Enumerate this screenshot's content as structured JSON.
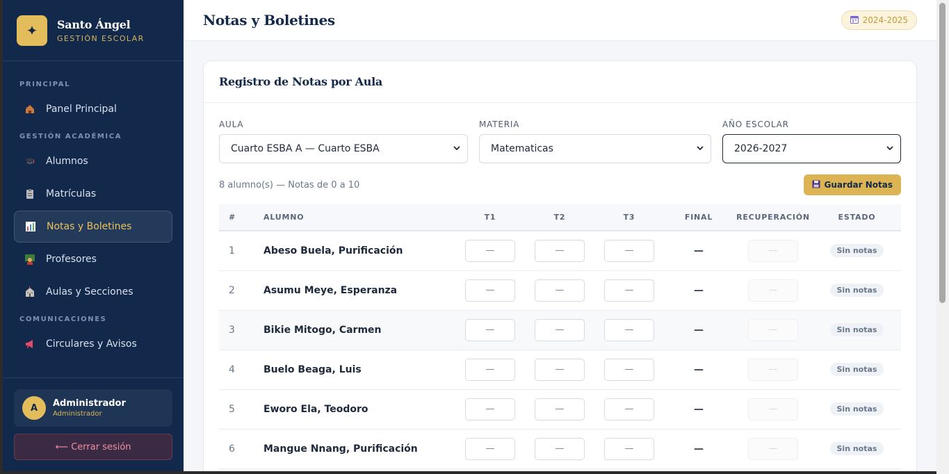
{
  "brand": {
    "name": "Santo Ángel",
    "subtitle": "GESTIÓN ESCOLAR",
    "logo_icon": "sparkle-icon"
  },
  "nav": {
    "section_principal": "PRINCIPAL",
    "section_academica": "GESTIÓN ACADÉMICA",
    "section_comunicaciones": "COMUNICACIONES",
    "items": [
      {
        "label": "Panel Principal",
        "icon": "house-icon"
      },
      {
        "label": "Alumnos",
        "icon": "graduation-cap-icon"
      },
      {
        "label": "Matrículas",
        "icon": "clipboard-icon"
      },
      {
        "label": "Notas y Boletines",
        "icon": "bar-chart-icon",
        "active": true
      },
      {
        "label": "Profesores",
        "icon": "teacher-icon"
      },
      {
        "label": "Aulas y Secciones",
        "icon": "school-icon"
      },
      {
        "label": "Circulares y Avisos",
        "icon": "megaphone-icon"
      }
    ]
  },
  "user": {
    "initial": "A",
    "name": "Administrador",
    "role": "Administrador"
  },
  "logout_label": "⟵ Cerrar sesión",
  "header": {
    "title": "Notas y Boletines",
    "year_badge": "2024-2025"
  },
  "card": {
    "title": "Registro de Notas por Aula",
    "filters": {
      "aula_label": "AULA",
      "aula_value": "Cuarto ESBA A — Cuarto ESBA",
      "materia_label": "MATERIA",
      "materia_value": "Matematicas",
      "anio_label": "AÑO ESCOLAR",
      "anio_value": "2026-2027"
    },
    "count_text": "8 alumno(s) — Notas de 0 a 10",
    "save_label": "Guardar Notas",
    "columns": [
      "#",
      "ALUMNO",
      "T1",
      "T2",
      "T3",
      "FINAL",
      "RECUPERACIÓN",
      "ESTADO"
    ],
    "rows": [
      {
        "n": "1",
        "name": "Abeso Buela, Purificación",
        "t1": "—",
        "t2": "—",
        "t3": "—",
        "final": "—",
        "rec": "—",
        "status": "Sin notas"
      },
      {
        "n": "2",
        "name": "Asumu Meye, Esperanza",
        "t1": "—",
        "t2": "—",
        "t3": "—",
        "final": "—",
        "rec": "—",
        "status": "Sin notas"
      },
      {
        "n": "3",
        "name": "Bikie Mitogo, Carmen",
        "t1": "—",
        "t2": "—",
        "t3": "—",
        "final": "—",
        "rec": "—",
        "status": "Sin notas"
      },
      {
        "n": "4",
        "name": "Buelo Beaga, Luis",
        "t1": "—",
        "t2": "—",
        "t3": "—",
        "final": "—",
        "rec": "—",
        "status": "Sin notas"
      },
      {
        "n": "5",
        "name": "Eworo Ela, Teodoro",
        "t1": "—",
        "t2": "—",
        "t3": "—",
        "final": "—",
        "rec": "—",
        "status": "Sin notas"
      },
      {
        "n": "6",
        "name": "Mangue Nnang, Purificación",
        "t1": "—",
        "t2": "—",
        "t3": "—",
        "final": "—",
        "rec": "—",
        "status": "Sin notas"
      }
    ]
  }
}
